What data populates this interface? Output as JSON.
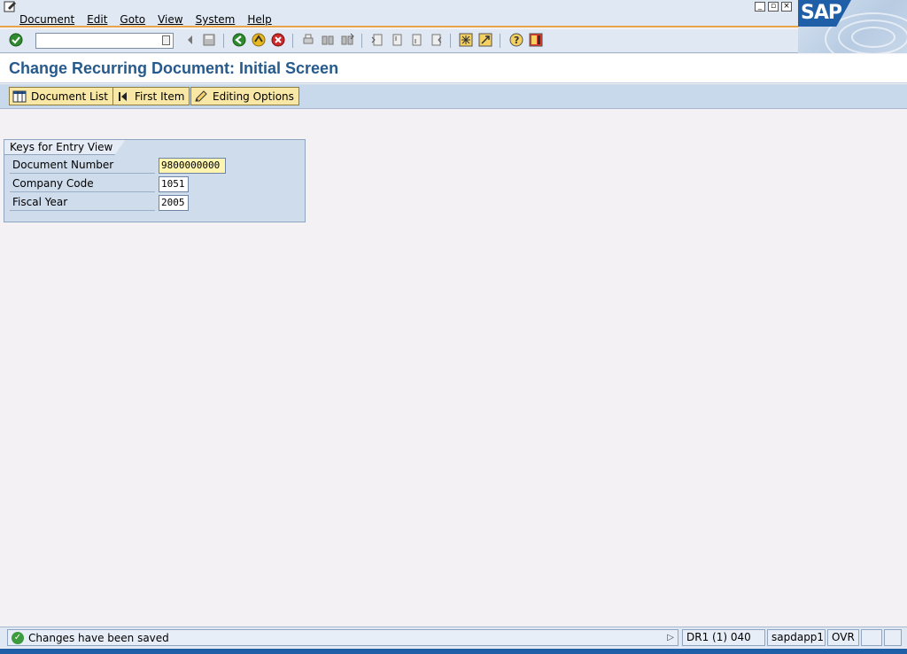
{
  "menu": {
    "items": [
      "Document",
      "Edit",
      "Goto",
      "View",
      "System",
      "Help"
    ]
  },
  "branding": {
    "logo_text": "SAP"
  },
  "title": {
    "text": "Change Recurring Document: Initial Screen"
  },
  "app_toolbar": {
    "buttons": [
      {
        "label": "Document List",
        "icon": "table-icon"
      },
      {
        "label": "First Item",
        "icon": "first-item-icon"
      },
      {
        "label": "Editing Options",
        "icon": "pencil-icon"
      }
    ]
  },
  "group": {
    "title": "Keys for Entry View",
    "fields": [
      {
        "label": "Document Number",
        "value": "9800000000"
      },
      {
        "label": "Company Code",
        "value": "1051"
      },
      {
        "label": "Fiscal Year",
        "value": "2005"
      }
    ]
  },
  "status": {
    "message": "Changes have been saved",
    "system": "DR1 (1) 040",
    "server": "sapdapp1",
    "mode": "OVR"
  },
  "colors": {
    "title": "#275a8c",
    "menu_accent": "#e8a44a",
    "button_bg": "#f9e7a6",
    "group_bg": "#cfdcec"
  }
}
